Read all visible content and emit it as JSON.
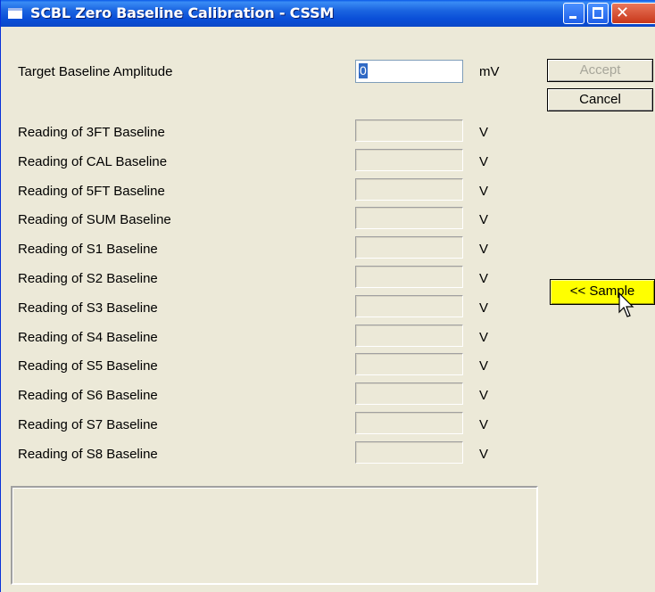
{
  "window": {
    "title": "SCBL Zero Baseline Calibration - CSSM"
  },
  "target": {
    "label": "Target Baseline Amplitude",
    "value": "0",
    "unit": "mV"
  },
  "readings": [
    {
      "label": "Reading of 3FT Baseline",
      "value": "",
      "unit": "V"
    },
    {
      "label": "Reading of CAL Baseline",
      "value": "",
      "unit": "V"
    },
    {
      "label": "Reading of 5FT Baseline",
      "value": "",
      "unit": "V"
    },
    {
      "label": "Reading of SUM Baseline",
      "value": "",
      "unit": "V"
    },
    {
      "label": "Reading of S1 Baseline",
      "value": "",
      "unit": "V"
    },
    {
      "label": "Reading of S2 Baseline",
      "value": "",
      "unit": "V"
    },
    {
      "label": "Reading of S3 Baseline",
      "value": "",
      "unit": "V"
    },
    {
      "label": "Reading of S4 Baseline",
      "value": "",
      "unit": "V"
    },
    {
      "label": "Reading of S5 Baseline",
      "value": "",
      "unit": "V"
    },
    {
      "label": "Reading of S6 Baseline",
      "value": "",
      "unit": "V"
    },
    {
      "label": "Reading of S7 Baseline",
      "value": "",
      "unit": "V"
    },
    {
      "label": "Reading of S8 Baseline",
      "value": "",
      "unit": "V"
    }
  ],
  "buttons": {
    "accept": "Accept",
    "cancel": "Cancel",
    "sample": "<< Sample"
  },
  "message": "",
  "colors": {
    "titlebar": "#0a4fd8",
    "sample_button": "#ffff00",
    "face": "#ece9d8"
  }
}
